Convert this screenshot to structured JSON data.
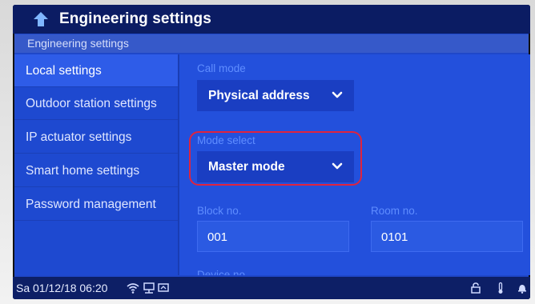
{
  "header": {
    "title": "Engineering settings"
  },
  "breadcrumb": "Engineering settings",
  "sidebar": {
    "items": [
      {
        "label": "Local settings"
      },
      {
        "label": "Outdoor station settings"
      },
      {
        "label": "IP actuator settings"
      },
      {
        "label": "Smart home settings"
      },
      {
        "label": "Password management"
      }
    ]
  },
  "main": {
    "call_mode": {
      "label": "Call mode",
      "value": "Physical address"
    },
    "mode_select": {
      "label": "Mode select",
      "value": "Master mode"
    },
    "block_no": {
      "label": "Block no.",
      "value": "001"
    },
    "room_no": {
      "label": "Room no.",
      "value": "0101"
    },
    "device_no": {
      "label": "Device no"
    }
  },
  "status": {
    "datetime": "Sa 01/12/18  06:20",
    "icons": [
      "wifi-icon",
      "network-icon",
      "monitor-icon",
      "lock-icon",
      "thermometer-icon",
      "bell-icon"
    ]
  },
  "colors": {
    "accent_red": "#e0233e",
    "header_bg": "#0b1c63",
    "label_blue": "#5f8dff"
  }
}
